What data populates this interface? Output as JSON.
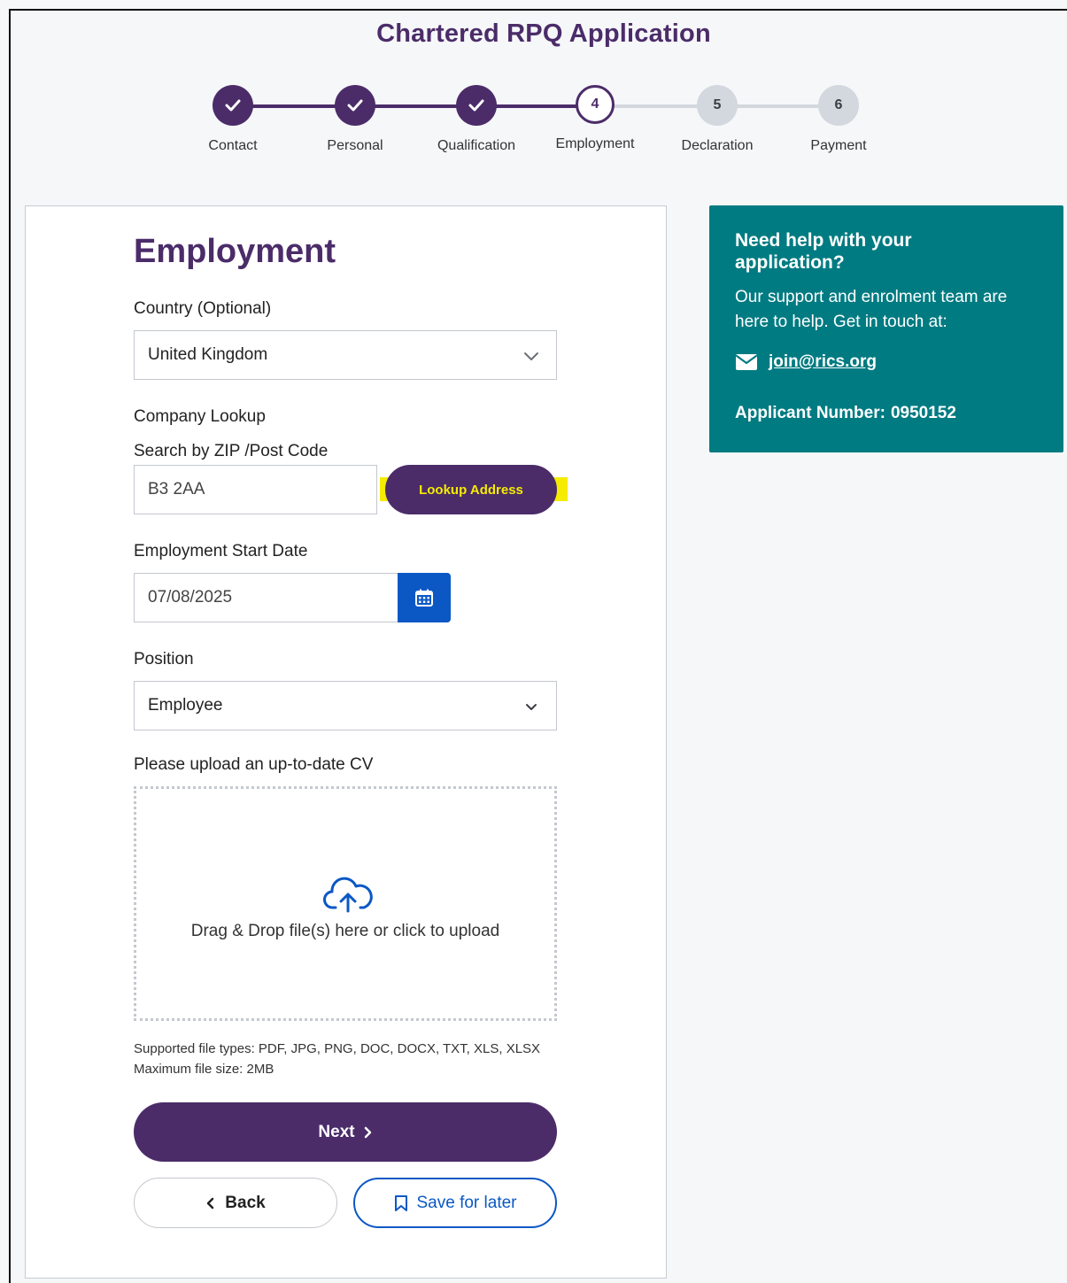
{
  "app": {
    "title": "Chartered RPQ Application"
  },
  "stepper": {
    "steps": [
      {
        "label": "Contact",
        "number": "1",
        "state": "done"
      },
      {
        "label": "Personal",
        "number": "2",
        "state": "done"
      },
      {
        "label": "Qualification",
        "number": "3",
        "state": "done"
      },
      {
        "label": "Employment",
        "number": "4",
        "state": "current"
      },
      {
        "label": "Declaration",
        "number": "5",
        "state": "todo"
      },
      {
        "label": "Payment",
        "number": "6",
        "state": "todo"
      }
    ]
  },
  "form": {
    "title": "Employment",
    "country": {
      "label": "Country (Optional)",
      "value": "United Kingdom"
    },
    "company_lookup": {
      "label": "Company Lookup",
      "sublabel": "Search by ZIP /Post Code",
      "value": "B3 2AA",
      "button_label": "Lookup Address"
    },
    "start_date": {
      "label": "Employment Start Date",
      "value": "07/08/2025"
    },
    "position": {
      "label": "Position",
      "value": "Employee"
    },
    "upload": {
      "label": "Please upload an up-to-date CV",
      "dropzone_text": "Drag & Drop file(s) here or click to upload",
      "supported_types": "Supported file types: PDF, JPG, PNG, DOC, DOCX, TXT, XLS, XLSX",
      "max_size": "Maximum file size: 2MB"
    },
    "buttons": {
      "next": "Next",
      "back": "Back",
      "save": "Save for later"
    }
  },
  "help": {
    "title": "Need help with your application?",
    "body": "Our support and enrolment team are here to help. Get in touch at:",
    "email": "join@rics.org",
    "applicant_label": "Applicant Number:",
    "applicant_number": "0950152"
  },
  "colors": {
    "brand_purple": "#4b2c69",
    "help_teal": "#007b82",
    "action_blue": "#0b58c5",
    "highlight_yellow": "#f5ec00"
  }
}
